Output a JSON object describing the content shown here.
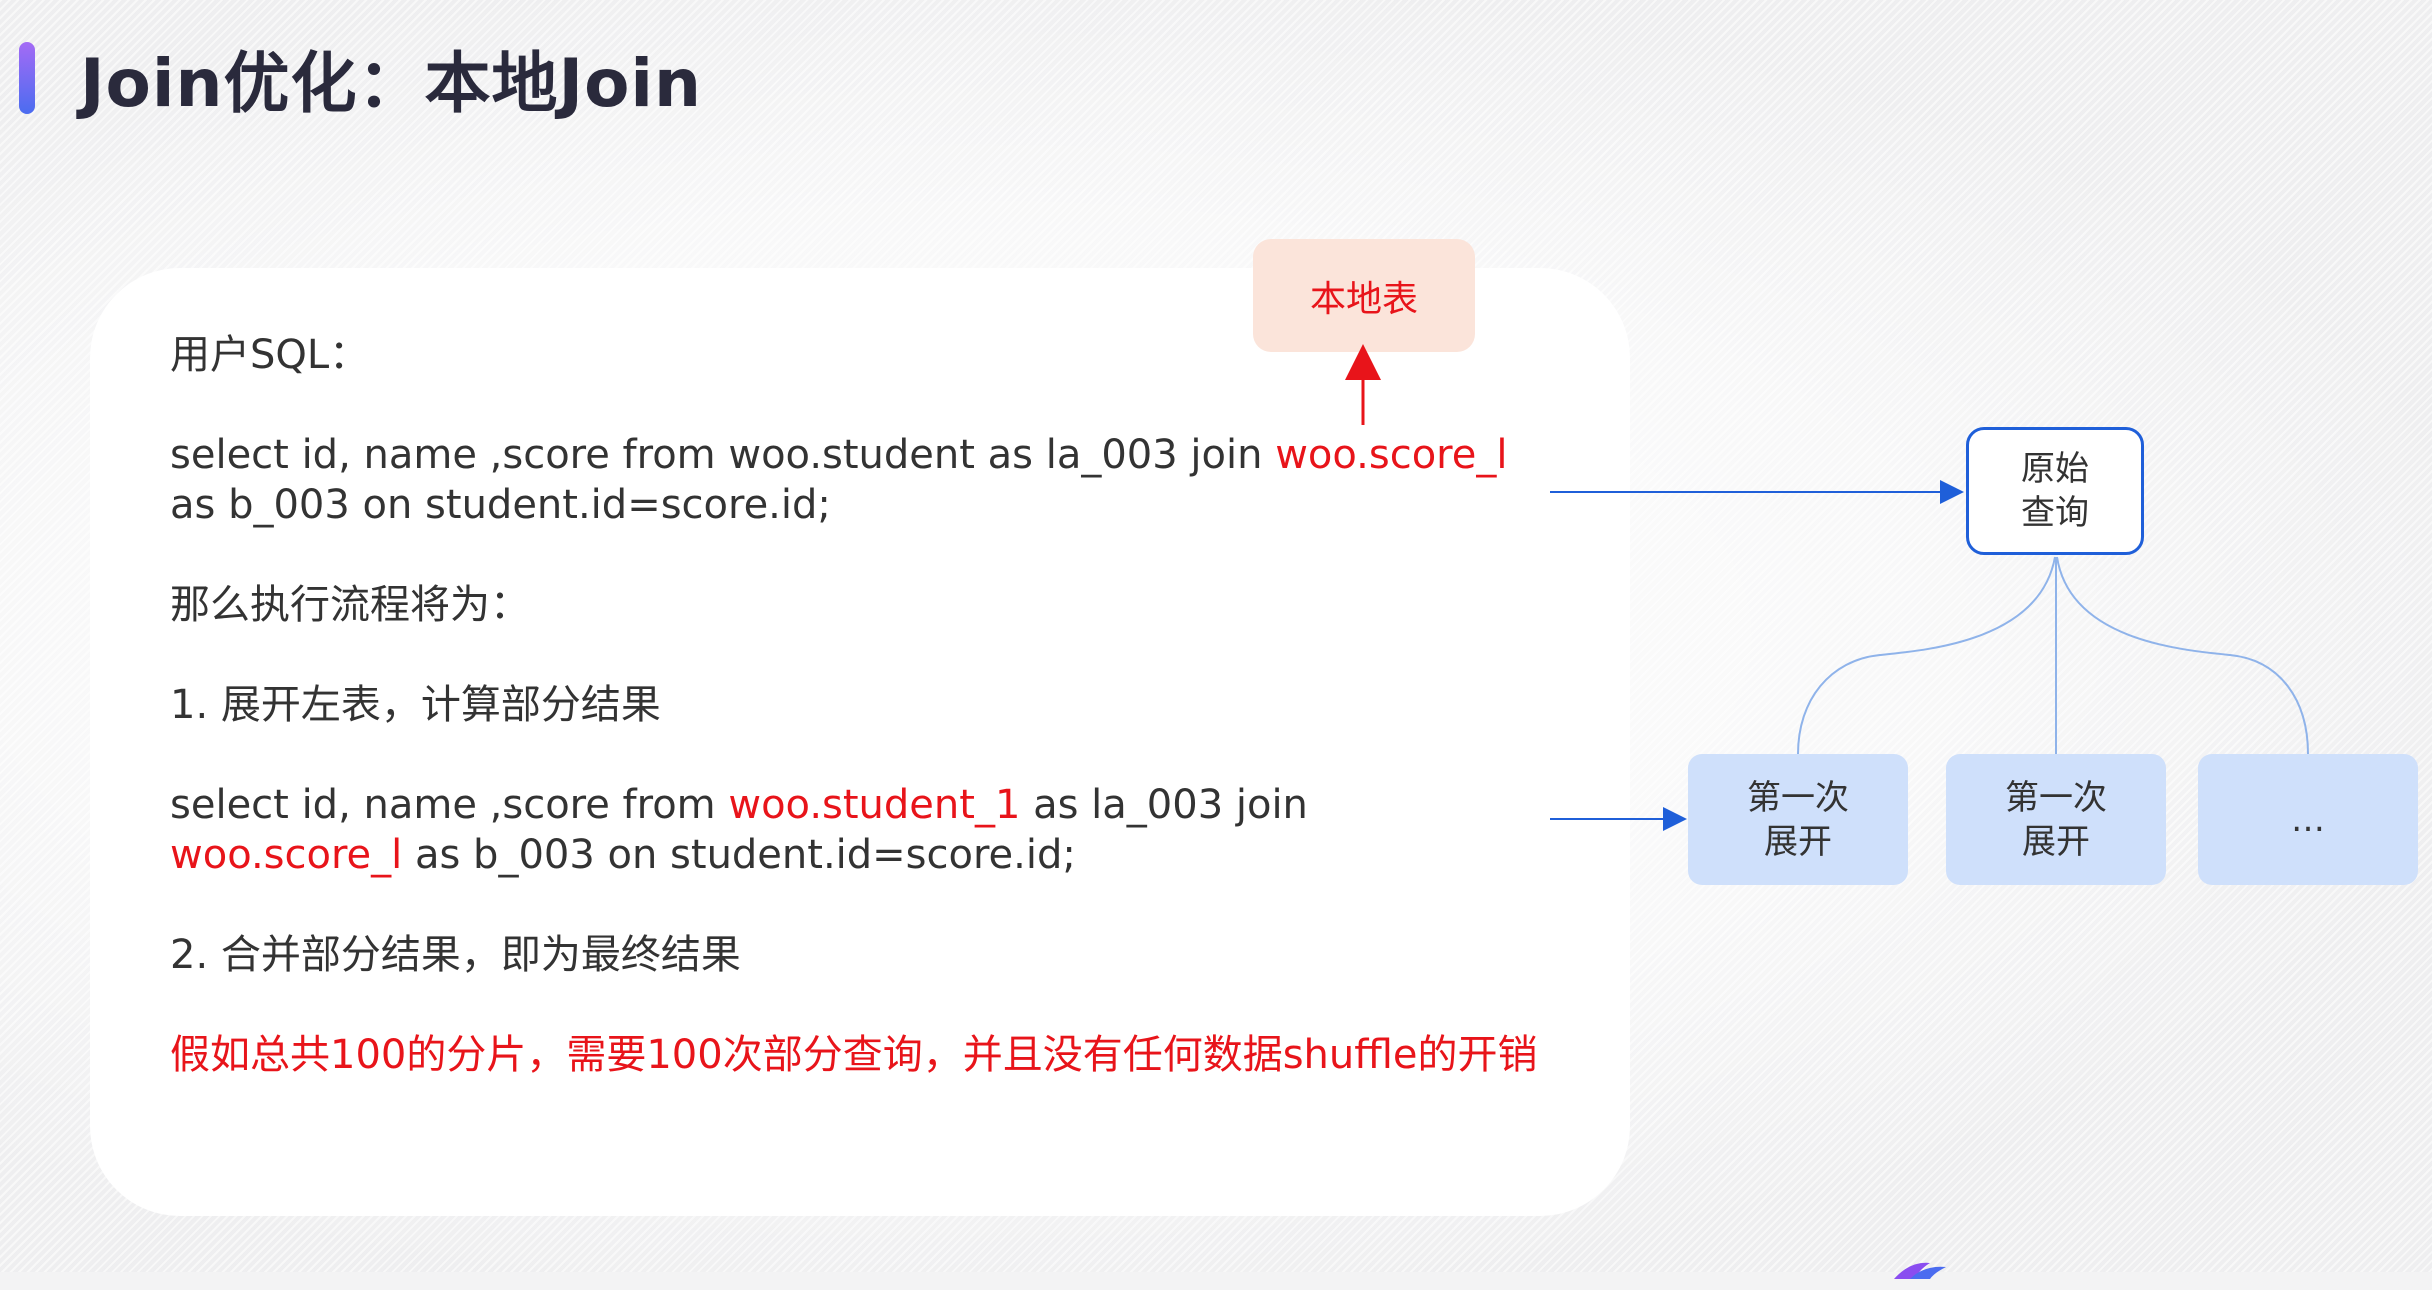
{
  "slide": {
    "title": "Join优化：本地Join"
  },
  "content": {
    "user_sql_label": "用户SQL：",
    "sql1_black": "select id, name ,score from woo.student as la_003 join ",
    "sql1_red": "woo.score_l",
    "sql1_line2": "as b_003 on student.id=score.id;",
    "flow_label": "那么执行流程将为：",
    "step1": "1. 展开左表，计算部分结果",
    "sql2_a": "select id, name ,score from ",
    "sql2_red1": "woo.student_1",
    "sql2_b": " as la_003 join",
    "sql2_red2": "woo.score_l",
    "sql2_c": " as b_003 on student.id=score.id;",
    "step2": "2. 合并部分结果，即为最终结果",
    "note": "假如总共100的分片，需要100次部分查询，并且没有任何数据shuffle的开销"
  },
  "diagram": {
    "local_table": "本地表",
    "origin_query_line1": "原始",
    "origin_query_line2": "查询",
    "expand1_line1": "第一次",
    "expand1_line2": "展开",
    "expand2_line1": "第一次",
    "expand2_line2": "展开",
    "expand3": "…"
  },
  "colors": {
    "accent_red": "#e8141a",
    "accent_blue": "#1f5fd9",
    "expand_fill": "#cfe0fb",
    "local_fill": "#fbe4da"
  }
}
